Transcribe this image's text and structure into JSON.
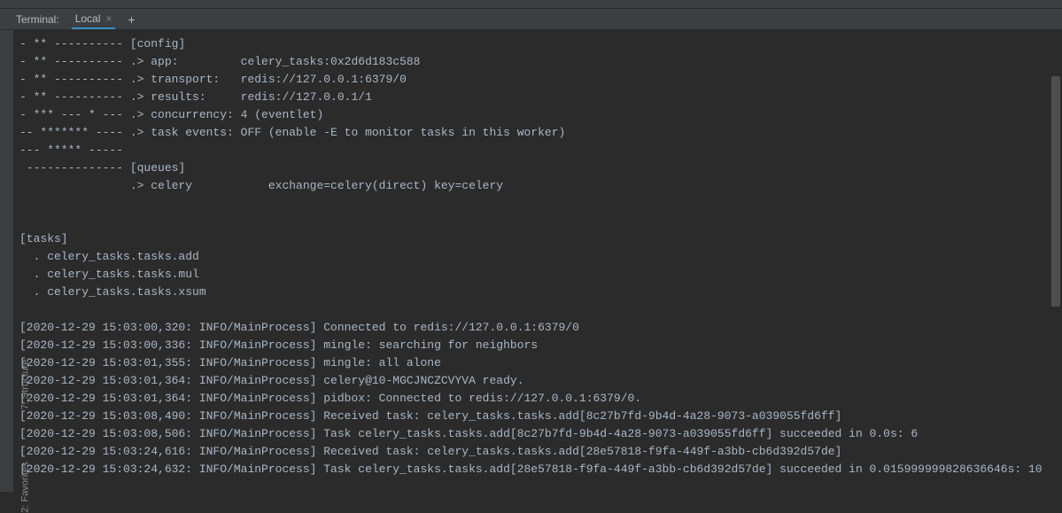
{
  "tabBar": {
    "title": "Terminal:",
    "activeTab": "Local",
    "close": "×",
    "add": "+"
  },
  "sideRail": {
    "structure": "7: Structure",
    "favorites": "2: Favorites"
  },
  "terminal": {
    "lines": [
      "- ** ---------- [config]",
      "- ** ---------- .> app:         celery_tasks:0x2d6d183c588",
      "- ** ---------- .> transport:   redis://127.0.0.1:6379/0",
      "- ** ---------- .> results:     redis://127.0.0.1/1",
      "- *** --- * --- .> concurrency: 4 (eventlet)",
      "-- ******* ---- .> task events: OFF (enable -E to monitor tasks in this worker)",
      "--- ***** -----",
      " -------------- [queues]",
      "                .> celery           exchange=celery(direct) key=celery",
      "",
      "",
      "[tasks]",
      "  . celery_tasks.tasks.add",
      "  . celery_tasks.tasks.mul",
      "  . celery_tasks.tasks.xsum",
      "",
      "[2020-12-29 15:03:00,320: INFO/MainProcess] Connected to redis://127.0.0.1:6379/0",
      "[2020-12-29 15:03:00,336: INFO/MainProcess] mingle: searching for neighbors",
      "[2020-12-29 15:03:01,355: INFO/MainProcess] mingle: all alone",
      "[2020-12-29 15:03:01,364: INFO/MainProcess] celery@10-MGCJNCZCVYVA ready.",
      "[2020-12-29 15:03:01,364: INFO/MainProcess] pidbox: Connected to redis://127.0.0.1:6379/0.",
      "[2020-12-29 15:03:08,490: INFO/MainProcess] Received task: celery_tasks.tasks.add[8c27b7fd-9b4d-4a28-9073-a039055fd6ff]",
      "[2020-12-29 15:03:08,506: INFO/MainProcess] Task celery_tasks.tasks.add[8c27b7fd-9b4d-4a28-9073-a039055fd6ff] succeeded in 0.0s: 6",
      "[2020-12-29 15:03:24,616: INFO/MainProcess] Received task: celery_tasks.tasks.add[28e57818-f9fa-449f-a3bb-cb6d392d57de]",
      "[2020-12-29 15:03:24,632: INFO/MainProcess] Task celery_tasks.tasks.add[28e57818-f9fa-449f-a3bb-cb6d392d57de] succeeded in 0.015999999828636646s: 10"
    ]
  }
}
